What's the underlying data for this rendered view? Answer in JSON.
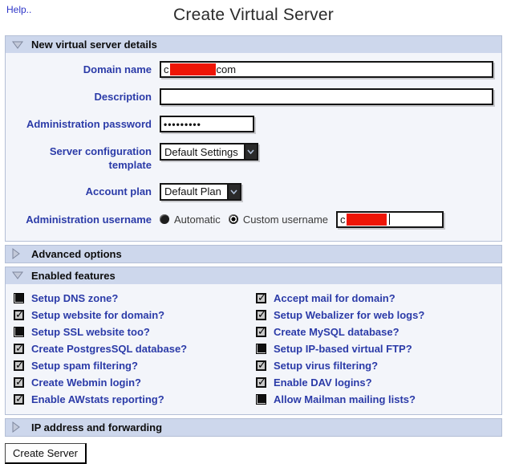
{
  "page": {
    "help_label": "Help..",
    "title": "Create Virtual Server"
  },
  "colors": {
    "section_header_bg": "#cdd7ec",
    "section_body_bg": "#f3f5fa",
    "label_blue": "#2b3ba8",
    "redaction_red": "#ee1506",
    "link_blue": "#2d35c8"
  },
  "sections": {
    "details": {
      "title": "New virtual server details",
      "expanded": true
    },
    "advanced": {
      "title": "Advanced options",
      "expanded": false
    },
    "features": {
      "title": "Enabled features",
      "expanded": true
    },
    "ip": {
      "title": "IP address and forwarding",
      "expanded": false
    }
  },
  "form": {
    "domain": {
      "label": "Domain name",
      "value_prefix": "c",
      "value_suffix": "com",
      "redacted": true
    },
    "description": {
      "label": "Description",
      "value": ""
    },
    "password": {
      "label": "Administration password",
      "masked_value": "•••••••••"
    },
    "template": {
      "label": "Server configuration template",
      "selected": "Default Settings"
    },
    "plan": {
      "label": "Account plan",
      "selected": "Default Plan"
    },
    "username": {
      "label": "Administration username",
      "options": [
        {
          "label": "Automatic",
          "selected": false
        },
        {
          "label": "Custom username",
          "selected": true
        }
      ],
      "value_prefix": "c",
      "redacted": true
    }
  },
  "features": {
    "left": [
      {
        "label": "Setup DNS zone?",
        "checked": false
      },
      {
        "label": "Setup website for domain?",
        "checked": true
      },
      {
        "label": "Setup SSL website too?",
        "checked": false
      },
      {
        "label": "Create PostgresSQL database?",
        "checked": true
      },
      {
        "label": "Setup spam filtering?",
        "checked": true
      },
      {
        "label": "Create Webmin login?",
        "checked": true
      },
      {
        "label": "Enable AWstats reporting?",
        "checked": true
      }
    ],
    "right": [
      {
        "label": "Accept mail for domain?",
        "checked": true
      },
      {
        "label": "Setup Webalizer for web logs?",
        "checked": true
      },
      {
        "label": "Create MySQL database?",
        "checked": true
      },
      {
        "label": "Setup IP-based virtual FTP?",
        "checked": false
      },
      {
        "label": "Setup virus filtering?",
        "checked": true
      },
      {
        "label": "Enable DAV logins?",
        "checked": true
      },
      {
        "label": "Allow Mailman mailing lists?",
        "checked": false
      }
    ]
  },
  "footer": {
    "create_button": "Create Server"
  }
}
